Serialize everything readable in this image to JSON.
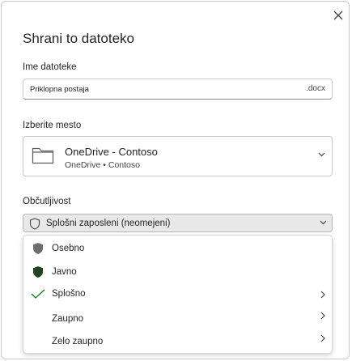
{
  "dialog": {
    "title": "Shrani to datoteko",
    "close_icon": "close-icon"
  },
  "filename": {
    "label": "Ime datoteke",
    "value": "Priklopna postaja",
    "extension": ".docx"
  },
  "location": {
    "label": "Izberite mesto",
    "name": "OneDrive - Contoso",
    "subtitle": "OneDrive • Contoso",
    "icon": "folder-icon"
  },
  "sensitivity": {
    "label": "Občutljivost",
    "selected": "Splošni zaposleni (neomejeni)",
    "icon": "shield-outline-icon",
    "menu": [
      {
        "label": "Osebno",
        "icon": "shield-gray-icon",
        "has_submenu": false
      },
      {
        "label": "Javno",
        "icon": "shield-green-icon",
        "has_submenu": false
      },
      {
        "label": "Splošno",
        "icon": "checkmark-icon",
        "has_submenu": true
      },
      {
        "label": "Zaupno",
        "icon": "",
        "has_submenu": true
      },
      {
        "label": "Zelo zaupno",
        "icon": "",
        "has_submenu": true
      }
    ]
  },
  "colors": {
    "shield_gray": "#6e6e6e",
    "shield_green": "#1e4620",
    "check_green": "#107c10",
    "dropdown_bg": "#e8e8e8"
  }
}
